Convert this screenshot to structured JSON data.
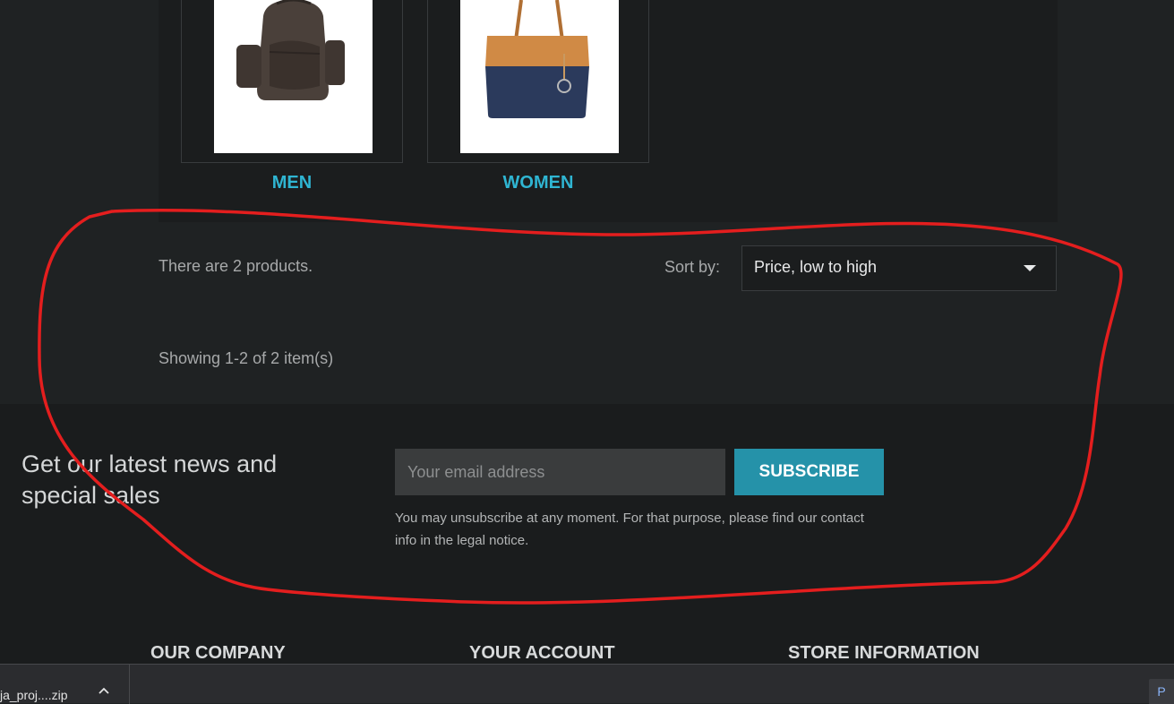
{
  "categories": [
    {
      "title": "MEN",
      "image": "backpack"
    },
    {
      "title": "WOMEN",
      "image": "tote-bag"
    }
  ],
  "listing": {
    "count_text": "There are 2 products.",
    "sort_label": "Sort by:",
    "sort_value": "Price, low to high",
    "showing_text": "Showing 1-2 of 2 item(s)"
  },
  "newsletter": {
    "heading": "Get our latest news and special sales",
    "email_placeholder": "Your email address",
    "subscribe_label": "SUBSCRIBE",
    "note": "You may unsubscribe at any moment. For that purpose, please find our contact info in the legal notice."
  },
  "footer": {
    "columns": [
      "OUR COMPANY",
      "YOUR ACCOUNT",
      "STORE INFORMATION"
    ]
  },
  "download_bar": {
    "file_name": "ja_proj....zip",
    "right_item": "P"
  },
  "colors": {
    "accent": "#2fb5d2",
    "subscribe": "#2592a9",
    "annotation": "#e41e1e"
  }
}
